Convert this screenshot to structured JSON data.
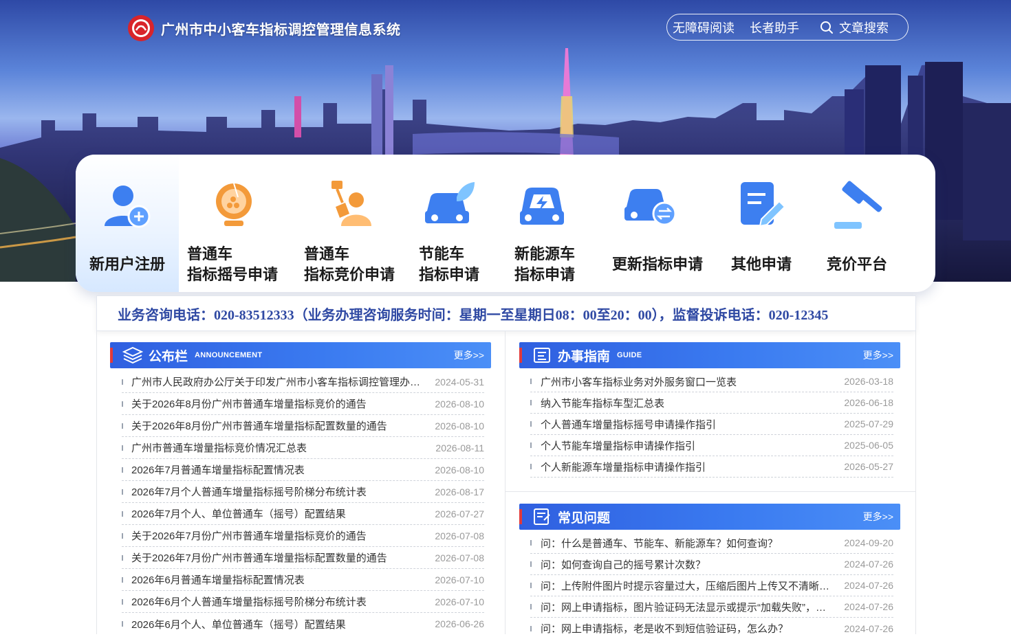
{
  "header": {
    "title": "广州市中小客车指标调控管理信息系统",
    "links": [
      {
        "label": "无障碍阅读"
      },
      {
        "label": "长者助手"
      }
    ],
    "search_label": "文章搜索",
    "logo_icon": "guangzhou-emblem-icon"
  },
  "services": [
    {
      "label_line1": "新用户注册",
      "label_line2": "",
      "icon": "new-user-icon"
    },
    {
      "label_line1": "普通车",
      "label_line2": "指标摇号申请",
      "icon": "lottery-icon"
    },
    {
      "label_line1": "普通车",
      "label_line2": "指标竞价申请",
      "icon": "bidding-icon"
    },
    {
      "label_line1": "节能车",
      "label_line2": "指标申请",
      "icon": "energy-saving-car-icon"
    },
    {
      "label_line1": "新能源车",
      "label_line2": "指标申请",
      "icon": "new-energy-car-icon"
    },
    {
      "label_line1": "更新指标申请",
      "label_line2": "",
      "icon": "update-car-icon"
    },
    {
      "label_line1": "其他申请",
      "label_line2": "",
      "icon": "edit-document-icon"
    },
    {
      "label_line1": "竞价平台",
      "label_line2": "",
      "icon": "auction-hammer-icon"
    }
  ],
  "hotline": "业务咨询电话：020-83512333（业务办理咨询服务时间：星期一至星期日08：00至20：00），监督投诉电话：020-12345",
  "announcement": {
    "title": "公布栏",
    "subtitle": "Announcement",
    "more": "更多>>",
    "items": [
      {
        "title": "广州市人民政府办公厅关于印发广州市小客车指标调控管理办法的通知",
        "date": "2024-05-31"
      },
      {
        "title": "关于2026年8月份广州市普通车增量指标竞价的通告",
        "date": "2026-08-10"
      },
      {
        "title": "关于2026年8月份广州市普通车增量指标配置数量的通告",
        "date": "2026-08-10"
      },
      {
        "title": "广州市普通车增量指标竞价情况汇总表",
        "date": "2026-08-11"
      },
      {
        "title": "2026年7月普通车增量指标配置情况表",
        "date": "2026-08-10"
      },
      {
        "title": "2026年7月个人普通车增量指标摇号阶梯分布统计表",
        "date": "2026-08-17"
      },
      {
        "title": "2026年7月个人、单位普通车（摇号）配置结果",
        "date": "2026-07-27"
      },
      {
        "title": "关于2026年7月份广州市普通车增量指标竞价的通告",
        "date": "2026-07-08"
      },
      {
        "title": "关于2026年7月份广州市普通车增量指标配置数量的通告",
        "date": "2026-07-08"
      },
      {
        "title": "2026年6月普通车增量指标配置情况表",
        "date": "2026-07-10"
      },
      {
        "title": "2026年6月个人普通车增量指标摇号阶梯分布统计表",
        "date": "2026-07-10"
      },
      {
        "title": "2026年6月个人、单位普通车（摇号）配置结果",
        "date": "2026-06-26"
      }
    ]
  },
  "guide": {
    "title": "办事指南",
    "subtitle": "Guide",
    "more": "更多>>",
    "items": [
      {
        "title": "广州市小客车指标业务对外服务窗口一览表",
        "date": "2026-03-18"
      },
      {
        "title": "纳入节能车指标车型汇总表",
        "date": "2026-06-18"
      },
      {
        "title": "个人普通车增量指标摇号申请操作指引",
        "date": "2025-07-29"
      },
      {
        "title": "个人节能车增量指标申请操作指引",
        "date": "2025-06-05"
      },
      {
        "title": "个人新能源车增量指标申请操作指引",
        "date": "2026-05-27"
      }
    ]
  },
  "faq": {
    "title": "常见问题",
    "more": "更多>>",
    "items": [
      {
        "title": "问：什么是普通车、节能车、新能源车？如何查询？",
        "date": "2024-09-20"
      },
      {
        "title": "问：如何查询自己的摇号累计次数？",
        "date": "2024-07-26"
      },
      {
        "title": "问：上传附件图片时提示容量过大，压缩后图片上传又不清晰怎么办？",
        "date": "2024-07-26"
      },
      {
        "title": "问：网上申请指标，图片验证码无法显示或提示“加载失败”，怎么办？",
        "date": "2024-07-26"
      },
      {
        "title": "问：网上申请指标，老是收不到短信验证码，怎么办？",
        "date": "2024-07-26"
      }
    ]
  },
  "colors": {
    "accent_blue": "#3a7af0",
    "hotline_text": "#2f49a3",
    "marker_red": "#e23a3a",
    "icon_blue": "#3d7ff0",
    "icon_orange": "#f39a3a"
  }
}
